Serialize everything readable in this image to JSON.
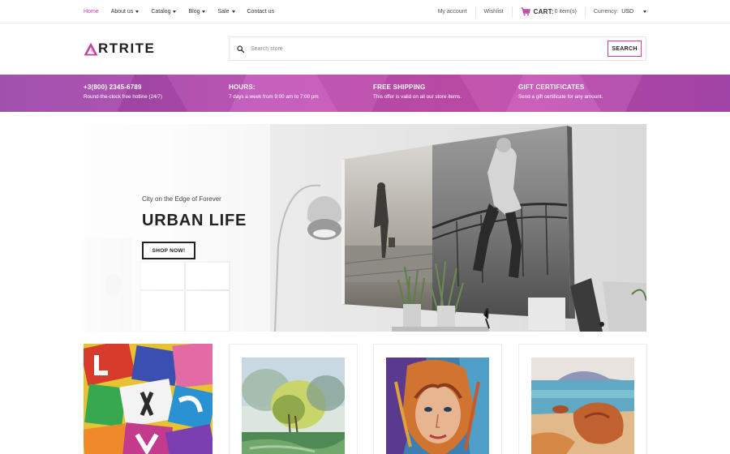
{
  "topbar": {
    "nav": [
      {
        "label": "Home",
        "active": true,
        "dropdown": false
      },
      {
        "label": "About us",
        "active": false,
        "dropdown": true
      },
      {
        "label": "Catalog",
        "active": false,
        "dropdown": true
      },
      {
        "label": "Blog",
        "active": false,
        "dropdown": true
      },
      {
        "label": "Sale",
        "active": false,
        "dropdown": true
      },
      {
        "label": "Contact us",
        "active": false,
        "dropdown": false
      }
    ],
    "my_account": "My account",
    "wishlist": "Wishlist",
    "cart_label": "CART:",
    "cart_items": "0 item(s)",
    "currency_label": "Currency:",
    "currency_value": "USD"
  },
  "header": {
    "logo_text": "RTRITE",
    "search_placeholder": "Search store",
    "search_button": "SEARCH"
  },
  "features": [
    {
      "title": "+3(800) 2345-6789",
      "subtitle": "Round-the-clock free hotline (24/7)"
    },
    {
      "title": "HOURS:",
      "subtitle": "7 days a week from 9:00 am to 7:00 pm"
    },
    {
      "title": "FREE SHIPPING",
      "subtitle": "This offer is valid on all our store items."
    },
    {
      "title": "GIFT CERTIFICATES",
      "subtitle": "Send a gift certificate for any amount."
    }
  ],
  "hero": {
    "subtitle": "City on the Edge of Forever",
    "title": "URBAN LIFE",
    "button": "SHOP NOW!",
    "slide_count": 4,
    "active_slide": 1
  },
  "colors": {
    "accent": "#d23ca4",
    "band": "#bf4fb6"
  },
  "icons": {
    "cart": "cart-icon",
    "search": "search-icon",
    "logo": "logo-mark-icon"
  }
}
